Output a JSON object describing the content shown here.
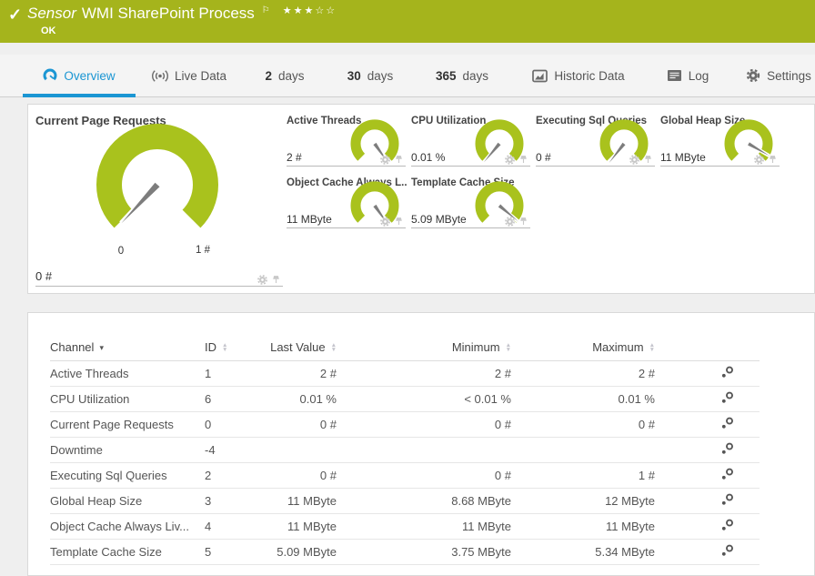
{
  "colors": {
    "brand_green": "#a5b41c",
    "gauge_green": "#a9c21d",
    "accent_blue": "#1b96d3",
    "needle_gray": "#7d7d7d"
  },
  "header": {
    "kind_label": "Sensor",
    "title": "WMI SharePoint Process",
    "status": "OK",
    "flag_icon": "flag-icon",
    "rating": {
      "filled": 3,
      "total": 5
    }
  },
  "tabs": {
    "items": [
      {
        "name": "overview",
        "label": "Overview",
        "icon": "gauge-icon",
        "active": true
      },
      {
        "name": "live-data",
        "label": "Live Data",
        "icon": "live-icon"
      },
      {
        "name": "2-days",
        "value": "2",
        "label": "days"
      },
      {
        "name": "30-days",
        "value": "30",
        "label": "days"
      },
      {
        "name": "365-days",
        "value": "365",
        "label": "days"
      },
      {
        "name": "historic-data",
        "label": "Historic Data",
        "icon": "chart-icon"
      },
      {
        "name": "log",
        "label": "Log",
        "icon": "log-icon"
      },
      {
        "name": "settings",
        "label": "Settings",
        "icon": "gear-icon"
      }
    ]
  },
  "gauges": {
    "main": {
      "title": "Current Page Requests",
      "value": "0 #",
      "scale_min": "0",
      "scale_max": "1 #",
      "needle_angle_deg": 133,
      "icons": [
        "gear-icon",
        "pin-icon"
      ]
    },
    "small": [
      {
        "name": "active-threads",
        "title": "Active Threads",
        "value": "2 #",
        "needle_angle_deg": 55
      },
      {
        "name": "cpu-utilization",
        "title": "CPU Utilization",
        "value": "0.01 %",
        "needle_angle_deg": 130
      },
      {
        "name": "executing-sql-queries",
        "title": "Executing Sql Queries",
        "value": "0 #",
        "needle_angle_deg": 128
      },
      {
        "name": "global-heap-size",
        "title": "Global Heap Size",
        "value": "11 MByte",
        "needle_angle_deg": 30
      },
      {
        "name": "object-cache-always-live",
        "title": "Object Cache Always L...",
        "value": "11 MByte",
        "needle_angle_deg": 55
      },
      {
        "name": "template-cache-size",
        "title": "Template Cache Size",
        "value": "5.09 MByte",
        "needle_angle_deg": 40
      }
    ]
  },
  "channels_table": {
    "columns": [
      {
        "label": "Channel",
        "sort": "desc"
      },
      {
        "label": "ID",
        "sort": "both"
      },
      {
        "label": "Last Value",
        "sort": "both"
      },
      {
        "label": "Minimum",
        "sort": "both"
      },
      {
        "label": "Maximum",
        "sort": "both"
      }
    ],
    "row_action_icon": "channel-settings-icon",
    "rows": [
      {
        "channel": "Active Threads",
        "id": "1",
        "last": "2 #",
        "min": "2 #",
        "max": "2 #"
      },
      {
        "channel": "CPU Utilization",
        "id": "6",
        "last": "0.01 %",
        "min": "< 0.01 %",
        "max": "0.01 %"
      },
      {
        "channel": "Current Page Requests",
        "id": "0",
        "last": "0 #",
        "min": "0 #",
        "max": "0 #"
      },
      {
        "channel": "Downtime",
        "id": "-4",
        "last": "",
        "min": "",
        "max": ""
      },
      {
        "channel": "Executing Sql Queries",
        "id": "2",
        "last": "0 #",
        "min": "0 #",
        "max": "1 #"
      },
      {
        "channel": "Global Heap Size",
        "id": "3",
        "last": "11 MByte",
        "min": "8.68 MByte",
        "max": "12 MByte"
      },
      {
        "channel": "Object Cache Always Liv...",
        "id": "4",
        "last": "11 MByte",
        "min": "11 MByte",
        "max": "11 MByte"
      },
      {
        "channel": "Template Cache Size",
        "id": "5",
        "last": "5.09 MByte",
        "min": "3.75 MByte",
        "max": "5.34 MByte"
      }
    ]
  }
}
